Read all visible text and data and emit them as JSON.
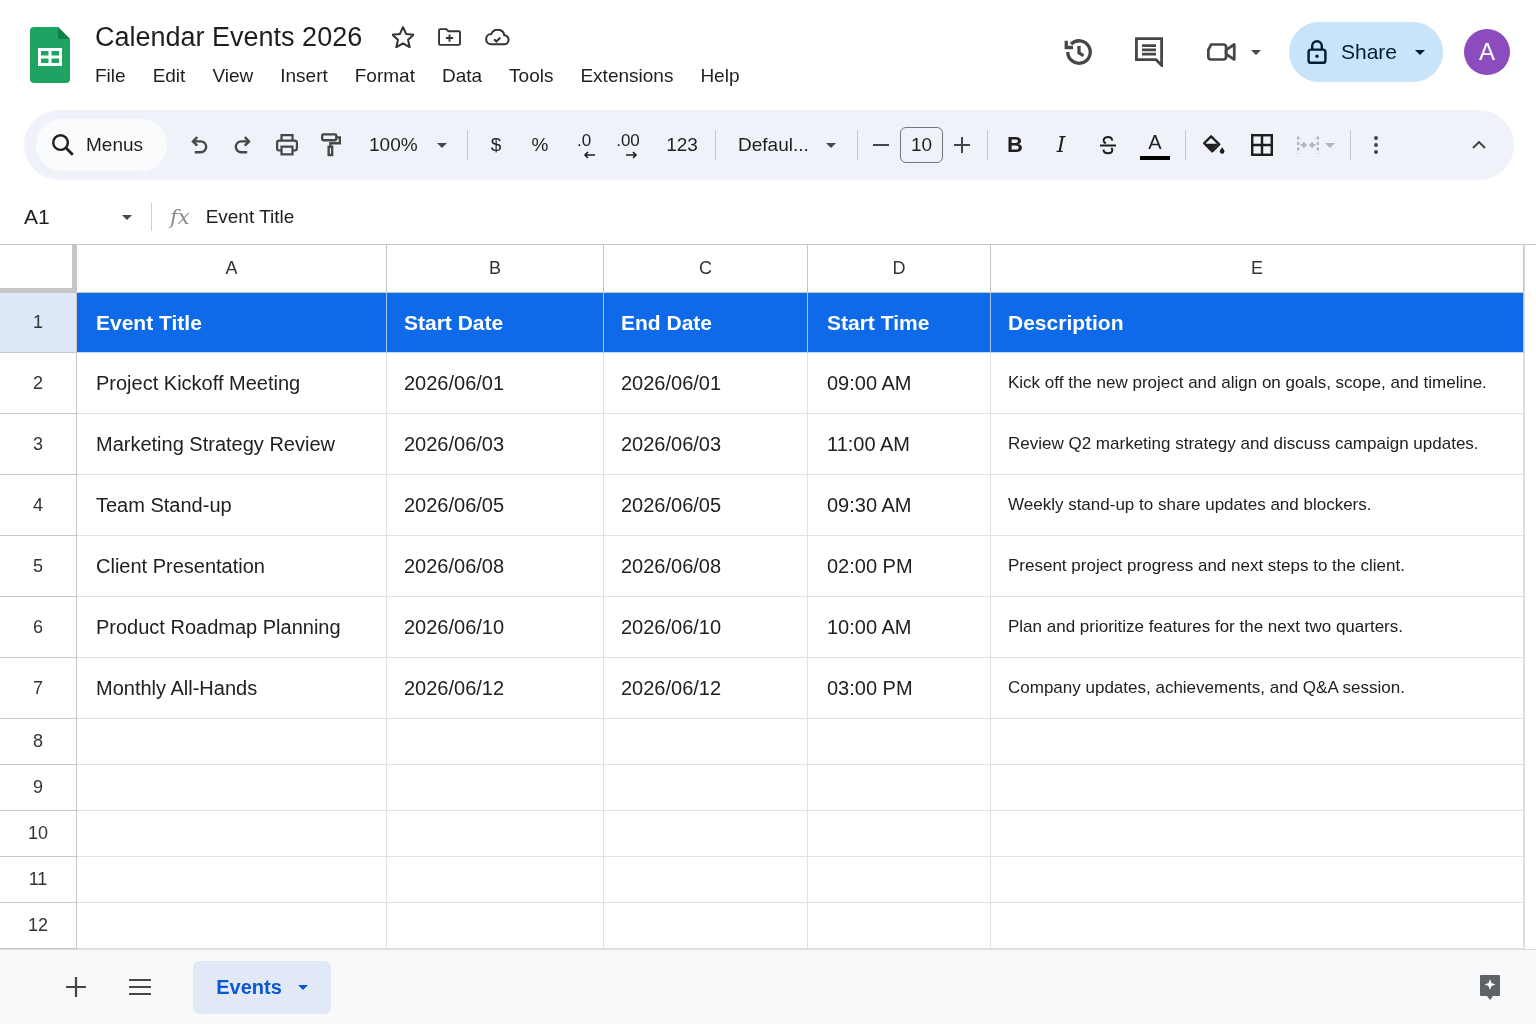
{
  "document": {
    "title": "Calendar Events 2026"
  },
  "menu": [
    "File",
    "Edit",
    "View",
    "Insert",
    "Format",
    "Data",
    "Tools",
    "Extensions",
    "Help"
  ],
  "account": {
    "share_label": "Share",
    "avatar_initial": "A"
  },
  "toolbar": {
    "search": {
      "placeholder": "Menus"
    },
    "zoom": "100%",
    "number_formats": [
      {
        "kind": "currency",
        "label": "$"
      },
      {
        "kind": "percent",
        "label": "%"
      },
      {
        "kind": "decrease_decimals",
        "label": ".0"
      },
      {
        "kind": "increase_decimals",
        "label": ".00"
      },
      {
        "kind": "more_formats",
        "label": "123"
      }
    ],
    "font": "Defaul...",
    "font_size": "10",
    "text_styles": [
      {
        "kind": "bold",
        "label": "B"
      },
      {
        "kind": "italic",
        "label": "I"
      },
      {
        "kind": "strikethrough"
      },
      {
        "kind": "text_color",
        "label": "A"
      }
    ],
    "merge": {
      "disabled": true
    }
  },
  "formula_bar": {
    "cell_reference": "A1",
    "function_symbol": "fx",
    "formula": "Event Title"
  },
  "grid": {
    "columns": [
      "A",
      "B",
      "C",
      "D",
      "E"
    ],
    "rows": [
      {
        "number": "1",
        "kind": "header",
        "selected": true,
        "cells": [
          "Event Title",
          "Start Date",
          "End Date",
          "Start Time",
          "Description"
        ]
      },
      {
        "number": "2",
        "kind": "data",
        "selected": false,
        "cells": [
          "Project Kickoff Meeting",
          "2026/06/01",
          "2026/06/01",
          "09:00 AM",
          "Kick off the new project and align on goals, scope, and timeline."
        ]
      },
      {
        "number": "3",
        "kind": "data",
        "selected": false,
        "cells": [
          "Marketing Strategy Review",
          "2026/06/03",
          "2026/06/03",
          "11:00 AM",
          "Review Q2 marketing strategy and discuss campaign updates."
        ]
      },
      {
        "number": "4",
        "kind": "data",
        "selected": false,
        "cells": [
          "Team Stand-up",
          "2026/06/05",
          "2026/06/05",
          "09:30 AM",
          "Weekly stand-up to share updates and blockers."
        ]
      },
      {
        "number": "5",
        "kind": "data",
        "selected": false,
        "cells": [
          "Client Presentation",
          "2026/06/08",
          "2026/06/08",
          "02:00 PM",
          "Present project progress and next steps to the client."
        ]
      },
      {
        "number": "6",
        "kind": "data",
        "selected": false,
        "cells": [
          "Product Roadmap Planning",
          "2026/06/10",
          "2026/06/10",
          "10:00 AM",
          "Plan and prioritize features for the next two quarters."
        ]
      },
      {
        "number": "7",
        "kind": "data",
        "selected": false,
        "cells": [
          "Monthly All-Hands",
          "2026/06/12",
          "2026/06/12",
          "03:00 PM",
          "Company updates, achievements, and Q&A session."
        ]
      },
      {
        "number": "8",
        "kind": "blank",
        "selected": false
      },
      {
        "number": "9",
        "kind": "blank",
        "selected": false
      },
      {
        "number": "10",
        "kind": "blank",
        "selected": false
      },
      {
        "number": "11",
        "kind": "blank",
        "selected": false
      },
      {
        "number": "12",
        "kind": "blank",
        "selected": false
      }
    ]
  },
  "sheet_tabs": [
    {
      "label": "Events",
      "selected": true
    }
  ]
}
